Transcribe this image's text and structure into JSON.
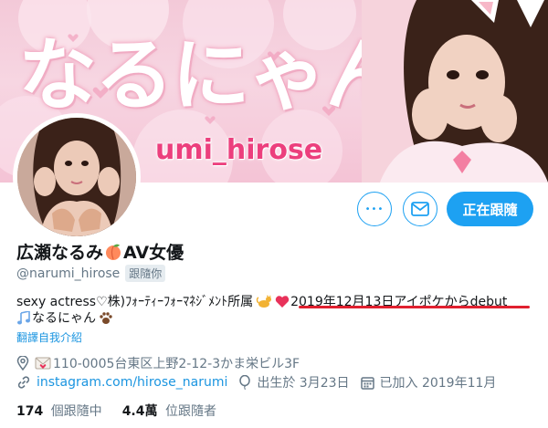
{
  "banner": {
    "title_text": "なるにゃん",
    "handle_text": "umi_hirose"
  },
  "actions": {
    "more_label": "•••",
    "follow_label": "正在跟隨"
  },
  "profile": {
    "name_prefix": "広瀬なるみ",
    "name_suffix": "AV女優",
    "handle": "@narumi_hirose",
    "follows_you": "跟隨你",
    "bio_line1_a": "sexy actress♡株)ﾌｫｰﾃｨｰﾌｫｰﾏﾈｼﾞﾒﾝﾄ所属",
    "bio_line1_date": "2019年12月13日アイポケからdebut",
    "bio_line2": "なるにゃん",
    "translate": "翻譯自我介紹"
  },
  "meta": {
    "location": "110-0005台東区上野2-12-3かま栄ビル3F",
    "url": "instagram.com/hirose_narumi",
    "birthday": "出生於 3月23日",
    "joined": "已加入 2019年11月"
  },
  "stats": {
    "following_count": "174",
    "following_label": "個跟隨中",
    "followers_count": "4.4萬",
    "followers_label": "位跟隨者"
  },
  "colors": {
    "accent": "#1da1f2",
    "link": "#1b95e0",
    "secondary_text": "#657786",
    "banner_handle": "#ec3f7d",
    "underline": "#e0202f"
  },
  "icons": [
    "more-icon",
    "mail-icon",
    "peach-icon",
    "cat-icon",
    "heart-icon",
    "music-notes-icon",
    "paw-icon",
    "location-icon",
    "envelope-emoji-icon",
    "link-icon",
    "balloon-icon",
    "calendar-icon"
  ]
}
